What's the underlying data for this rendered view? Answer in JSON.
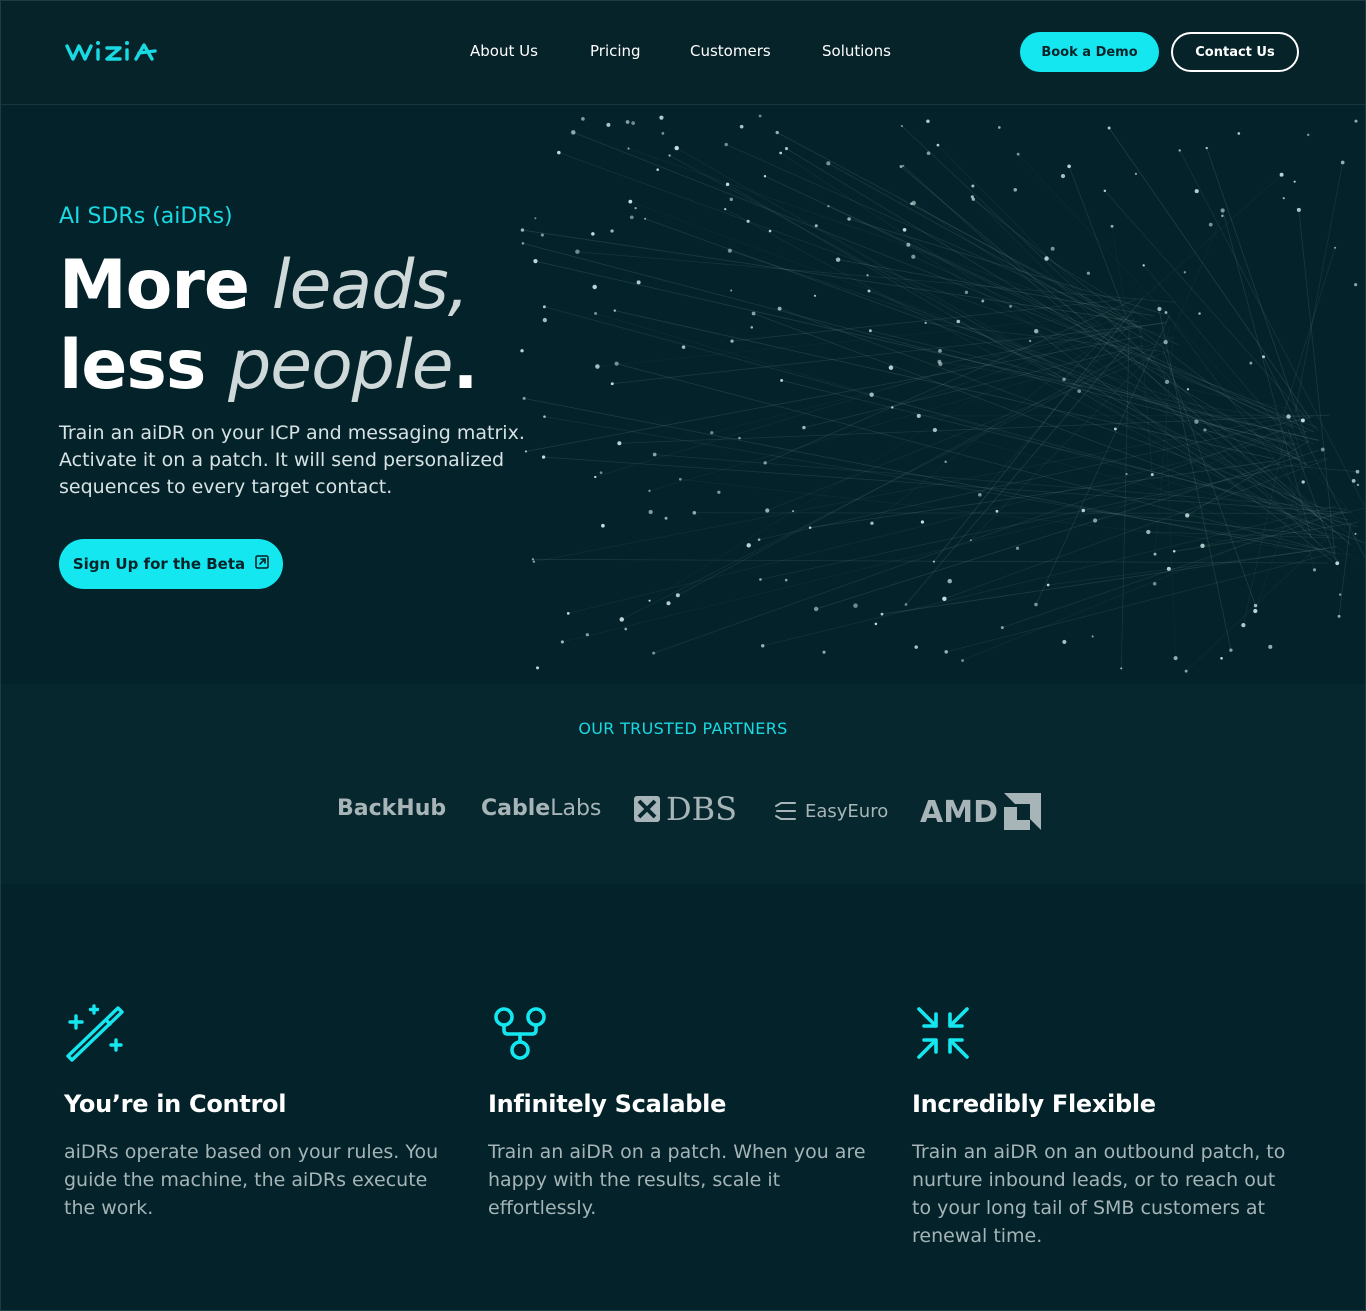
{
  "nav": {
    "logo_text": "wizia",
    "links": [
      "About Us",
      "Pricing",
      "Customers",
      "Solutions"
    ],
    "book_demo": "Book a Demo",
    "contact": "Contact Us"
  },
  "hero": {
    "eyebrow": "AI SDRs (aiDRs)",
    "headline": {
      "w1": "More",
      "w2": "leads,",
      "w3": "less",
      "w4": "people",
      "w5": "."
    },
    "description": "Train an aiDR on your ICP and messaging matrix. Activate it on a patch. It will send personalized sequences to every target contact.",
    "cta": "Sign Up for the Beta"
  },
  "partners": {
    "title": "OUR TRUSTED PARTNERS",
    "logos": {
      "backhub": "BackHub",
      "cablelabs_a": "Cable",
      "cablelabs_b": "Labs",
      "dbs": "DBS",
      "easyeuro": "EasyEuro",
      "amd": "AMD"
    }
  },
  "features": [
    {
      "icon": "magic-wand-icon",
      "title": "You’re in Control",
      "text": "aiDRs operate based on your rules. You guide the machine, the aiDRs execute the work."
    },
    {
      "icon": "git-branch-icon",
      "title": "Infinitely Scalable",
      "text": "Train an aiDR on a patch. When you are happy with the results, scale it effortlessly."
    },
    {
      "icon": "arrows-converge-icon",
      "title": "Incredibly Flexible",
      "text": "Train an aiDR on an outbound patch, to nurture inbound leads, or to reach out to your long tail of SMB customers at renewal time."
    }
  ],
  "colors": {
    "accent": "#14e7ef",
    "background": "#032229",
    "partner_band": "#07272e"
  }
}
